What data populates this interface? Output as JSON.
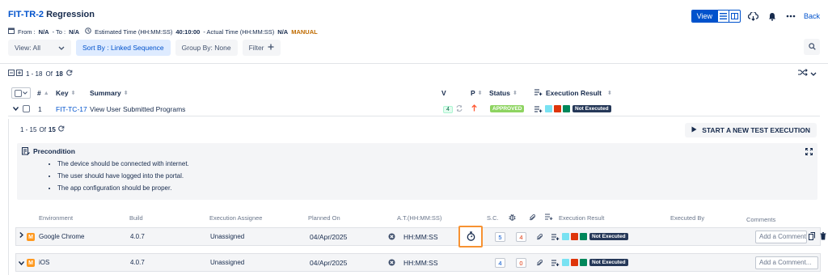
{
  "header": {
    "title_key": "FIT-TR-2",
    "title_name": "Regression",
    "view_label": "View",
    "back_label": "Back"
  },
  "meta": {
    "from_label": "From :",
    "from_value": "N/A",
    "to_label": "- To :",
    "to_value": "N/A",
    "estimated_label": "Estimated Time (HH:MM:SS)",
    "estimated_value": "40:10:00",
    "actual_label": "- Actual Time (HH:MM:SS)",
    "actual_value": "N/A",
    "mode_badge": "MANUAL"
  },
  "toolbar": {
    "view_select": "View: All",
    "sort_label": "Sort By : Linked Sequence",
    "group_label": "Group By: None",
    "filter_label": "Filter"
  },
  "pager_top": {
    "range": "1 - 18",
    "of_label": "Of",
    "total": "18"
  },
  "main_table": {
    "columns": {
      "num": "#",
      "key": "Key",
      "summary": "Summary",
      "v": "V",
      "p": "P",
      "status": "Status",
      "result": "Execution Result"
    },
    "row": {
      "num": "1",
      "key": "FIT-TC-17",
      "summary": "View User Submitted Programs",
      "version": "4",
      "status": "APPROVED",
      "result": "Not Executed"
    }
  },
  "panel": {
    "pager": {
      "range": "1 - 15",
      "of_label": "Of",
      "total": "15"
    },
    "start_button": "START A NEW TEST EXECUTION",
    "precondition_title": "Precondition",
    "precondition_items": [
      "The device should be connected with internet.",
      "The user should have logged into the portal.",
      "The app configuration should be proper."
    ]
  },
  "executions": {
    "columns": {
      "environment": "Environment",
      "build": "Build",
      "assignee": "Execution Assignee",
      "planned": "Planned On",
      "at": "A.T.(HH:MM:SS)",
      "sc": "S.C.",
      "result": "Execution Result",
      "executed_by": "Executed By",
      "comments": "Comments"
    },
    "rows": [
      {
        "badge": "M",
        "environment": "Google Chrome",
        "build": "4.0.7",
        "assignee": "Unassigned",
        "planned": "04/Apr/2025",
        "at": "HH:MM:SS",
        "sc": "5",
        "defects": "4",
        "result": "Not Executed",
        "comment_placeholder": "Add a Comment..."
      },
      {
        "badge": "M",
        "environment": "iOS",
        "build": "4.0.7",
        "assignee": "Unassigned",
        "planned": "04/Apr/2025",
        "at": "HH:MM:SS",
        "sc": "4",
        "defects": "0",
        "result": "Not Executed",
        "comment_placeholder": "Add a Comment..."
      }
    ]
  },
  "colors": {
    "accent": "#0052cc",
    "highlight": "#f79232",
    "approved": "#8ed461",
    "result_light_blue": "#79e2f2",
    "result_red": "#de350b",
    "result_green": "#00875a"
  }
}
